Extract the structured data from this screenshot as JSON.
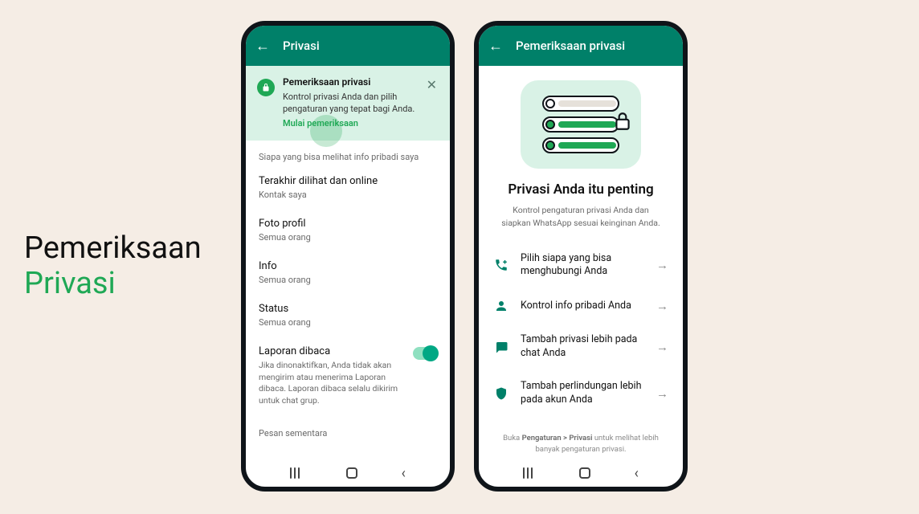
{
  "leftTitle": {
    "line1": "Pemeriksaan",
    "line2": "Privasi"
  },
  "phone1": {
    "appbar": "Privasi",
    "banner": {
      "title": "Pemeriksaan privasi",
      "body": "Kontrol privasi Anda dan pilih pengaturan yang tepat bagi Anda.",
      "link": "Mulai pemeriksaan"
    },
    "sectionHeader1": "Siapa yang bisa melihat info pribadi saya",
    "rows": [
      {
        "label": "Terakhir dilihat dan online",
        "value": "Kontak saya"
      },
      {
        "label": "Foto profil",
        "value": "Semua orang"
      },
      {
        "label": "Info",
        "value": "Semua orang"
      },
      {
        "label": "Status",
        "value": "Semua orang"
      }
    ],
    "readReceipts": {
      "label": "Laporan dibaca",
      "desc": "Jika dinonaktifkan, Anda tidak akan mengirim atau menerima Laporan dibaca. Laporan dibaca selalu dikirim untuk chat grup."
    },
    "sectionHeader2": "Pesan sementara"
  },
  "phone2": {
    "appbar": "Pemeriksaan privasi",
    "heroTitle": "Privasi Anda itu penting",
    "heroSub": "Kontrol pengaturan privasi Anda dan siapkan WhatsApp sesuai keinginan Anda.",
    "options": [
      {
        "icon": "phone-plus",
        "text": "Pilih siapa yang bisa menghubungi Anda"
      },
      {
        "icon": "person",
        "text": "Kontrol info pribadi Anda"
      },
      {
        "icon": "chat-lock",
        "text": "Tambah privasi lebih pada chat Anda"
      },
      {
        "icon": "shield-lock",
        "text": "Tambah perlindungan lebih pada akun Anda"
      }
    ],
    "footer": {
      "pre": "Buka ",
      "bold": "Pengaturan > Privasi",
      "post": " untuk melihat lebih banyak pengaturan privasi."
    }
  }
}
